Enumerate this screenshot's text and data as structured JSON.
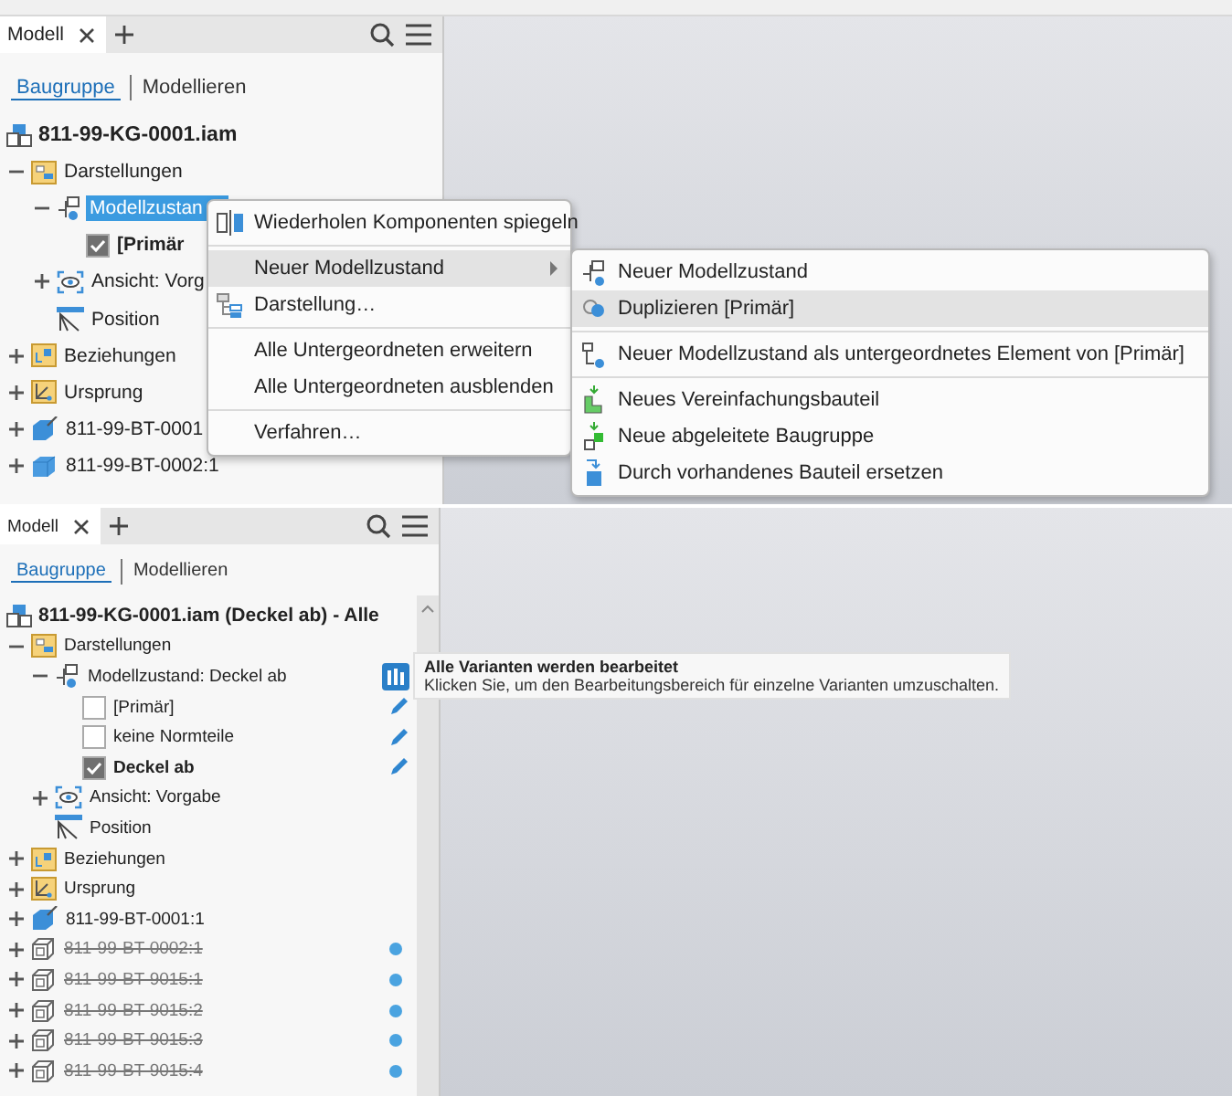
{
  "sections": [
    {
      "tab": "Modell",
      "mode_tabs": [
        {
          "label": "Baugruppe",
          "selected": true
        },
        {
          "label": "Modellieren",
          "selected": false
        }
      ],
      "root": {
        "label": "811-99-KG-0001.iam",
        "kind": "assembly"
      },
      "tree": [
        {
          "label": "Darstellungen",
          "kind": "representations",
          "expanded": true,
          "selected": false,
          "children": [
            {
              "label": "Modellzustan",
              "kind": "model-state",
              "expanded": true,
              "selected": true,
              "children": [
                {
                  "label": "[Primär",
                  "kind": "variant",
                  "checked": true,
                  "selected": false
                }
              ]
            },
            {
              "label": "Ansicht: Vorg",
              "kind": "view",
              "expanded": false,
              "selected": false
            },
            {
              "label": "Position",
              "kind": "position",
              "selected": false
            }
          ]
        },
        {
          "label": "Beziehungen",
          "kind": "relationships",
          "expanded": false,
          "selected": false
        },
        {
          "label": "Ursprung",
          "kind": "origin",
          "expanded": false,
          "selected": false
        },
        {
          "label": "811-99-BT-0001",
          "kind": "part-grounded",
          "expanded": false,
          "selected": false
        },
        {
          "label": "811-99-BT-0002:1",
          "kind": "part",
          "expanded": false,
          "selected": false
        }
      ],
      "context_menu": [
        {
          "kind": "mirror",
          "label": "Wiederholen Komponenten spiegeln",
          "selected": false
        },
        {
          "kind": "separator"
        },
        {
          "kind": "submenu",
          "label": "Neuer Modellzustand",
          "selected": true
        },
        {
          "kind": "representation",
          "label": "Darstellung…",
          "selected": false
        },
        {
          "kind": "separator"
        },
        {
          "kind": "text",
          "label": "Alle Untergeordneten erweitern",
          "selected": false
        },
        {
          "kind": "text",
          "label": "Alle Untergeordneten ausblenden",
          "selected": false
        },
        {
          "kind": "separator"
        },
        {
          "kind": "text",
          "label": "Verfahren…",
          "selected": false
        }
      ],
      "submenu": [
        {
          "kind": "new-state",
          "label": "Neuer Modellzustand",
          "selected": false
        },
        {
          "kind": "duplicate",
          "label": "Duplizieren [Primär]",
          "selected": true
        },
        {
          "kind": "separator"
        },
        {
          "kind": "child-state",
          "label": "Neuer Modellzustand als untergeordnetes Element von [Primär]",
          "selected": false
        },
        {
          "kind": "separator"
        },
        {
          "kind": "simplify",
          "label": "Neues Vereinfachungsbauteil",
          "selected": false
        },
        {
          "kind": "derive",
          "label": "Neue abgeleitete Baugruppe",
          "selected": false
        },
        {
          "kind": "replace",
          "label": "Durch vorhandenes Bauteil ersetzen",
          "selected": false
        }
      ]
    },
    {
      "tab": "Modell",
      "mode_tabs": [
        {
          "label": "Baugruppe",
          "selected": true
        },
        {
          "label": "Modellieren",
          "selected": false
        }
      ],
      "root": {
        "label": "811-99-KG-0001.iam (Deckel ab) - Alle",
        "kind": "assembly"
      },
      "tree": [
        {
          "label": "Darstellungen",
          "kind": "representations",
          "expanded": true,
          "selected": false,
          "children": [
            {
              "label": "Modellzustand: Deckel ab",
              "kind": "model-state-variants",
              "expanded": true,
              "selected": false,
              "children": [
                {
                  "label": "[Primär]",
                  "kind": "variant-editable",
                  "checked": false,
                  "selected": false
                },
                {
                  "label": "keine Normteile",
                  "kind": "variant-editable",
                  "checked": false,
                  "selected": false
                },
                {
                  "label": "Deckel ab",
                  "kind": "variant-editable",
                  "checked": true,
                  "selected": false
                }
              ]
            },
            {
              "label": "Ansicht: Vorgabe",
              "kind": "view",
              "expanded": false,
              "selected": false
            },
            {
              "label": "Position",
              "kind": "position",
              "selected": false
            }
          ]
        },
        {
          "label": "Beziehungen",
          "kind": "relationships",
          "expanded": false,
          "selected": false
        },
        {
          "label": "Ursprung",
          "kind": "origin",
          "expanded": false,
          "selected": false
        },
        {
          "label": "811-99-BT-0001:1",
          "kind": "part-grounded",
          "expanded": false,
          "selected": false
        },
        {
          "label": "811-99-BT-0002:1",
          "kind": "part-suppressed",
          "expanded": false,
          "selected": false
        },
        {
          "label": "811-99-BT-9015:1",
          "kind": "part-suppressed",
          "expanded": false,
          "selected": false
        },
        {
          "label": "811-99-BT-9015:2",
          "kind": "part-suppressed",
          "expanded": false,
          "selected": false
        },
        {
          "label": "811-99-BT-9015:3",
          "kind": "part-suppressed",
          "expanded": false,
          "selected": false
        },
        {
          "label": "811-99-BT-9015:4",
          "kind": "part-suppressed",
          "expanded": false,
          "selected": false
        }
      ],
      "tooltip": {
        "title": "Alle Varianten werden bearbeitet",
        "text": "Klicken Sie, um den Bearbeitungsbereich für einzelne Varianten umzuschalten."
      }
    }
  ]
}
